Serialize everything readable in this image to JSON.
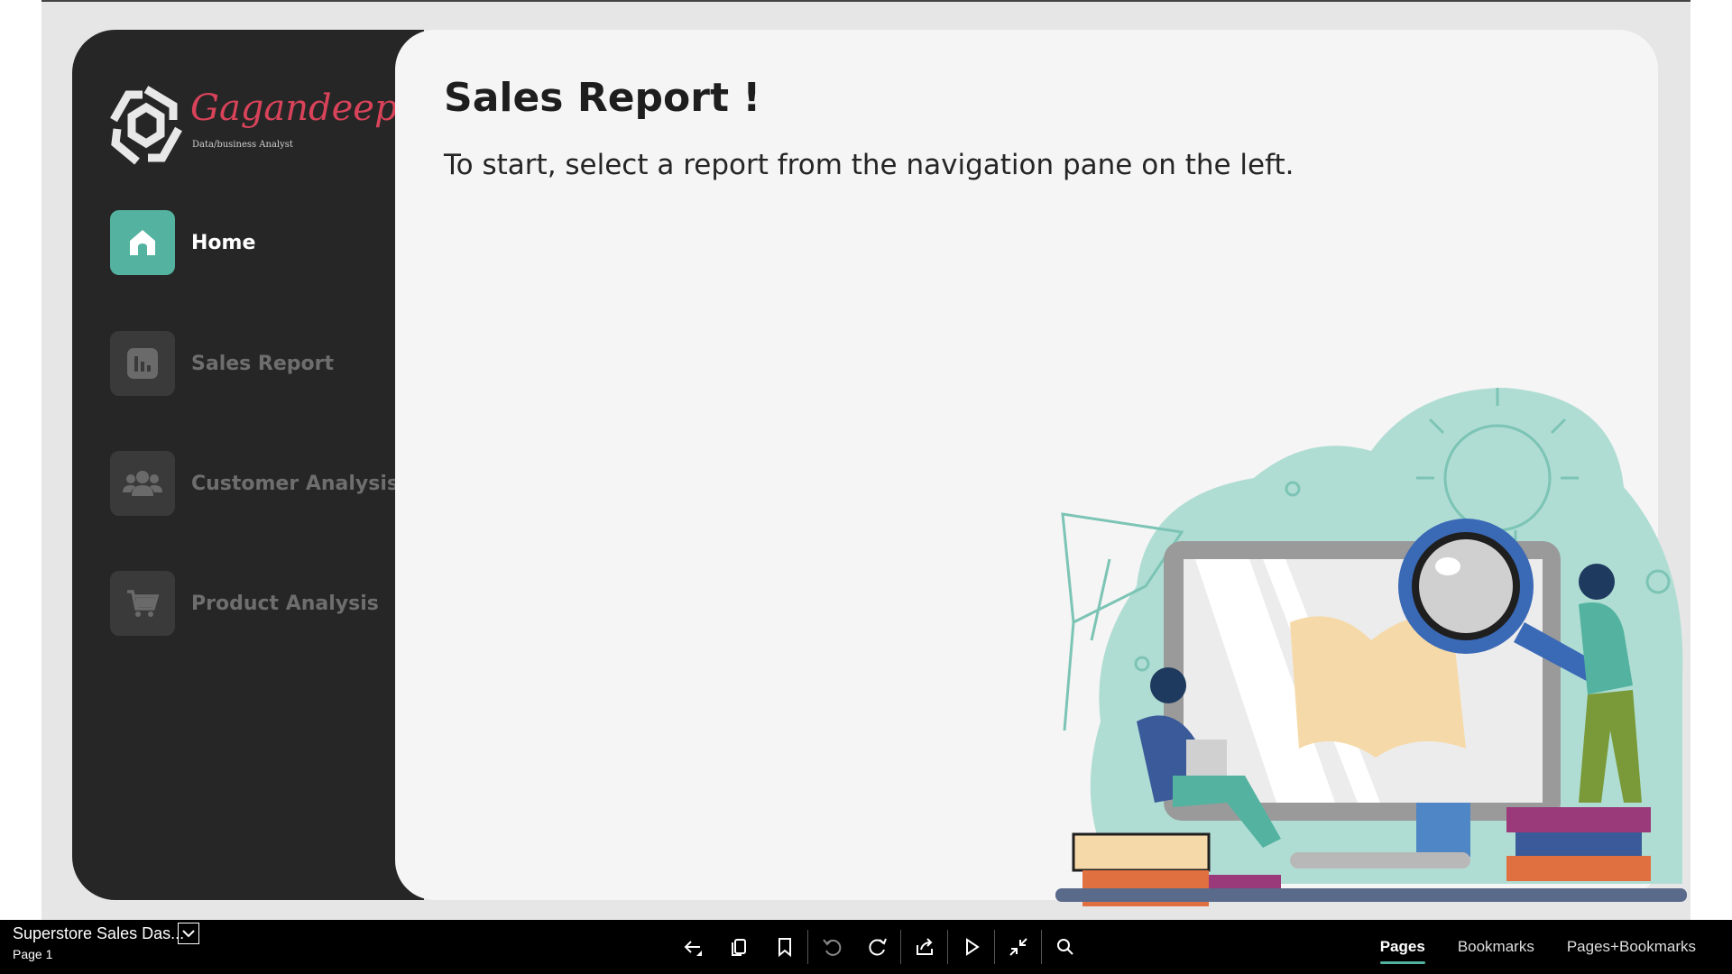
{
  "report": {
    "title": "Sales Report !",
    "subtitle": "To start, select a report from the navigation pane on the left."
  },
  "logo": {
    "name": "Gagandeep",
    "tagline": "Data/business Analyst"
  },
  "nav": {
    "items": [
      {
        "label": "Home",
        "icon": "home-icon",
        "active": true
      },
      {
        "label": "Sales Report",
        "icon": "bar-chart-icon",
        "active": false
      },
      {
        "label": "Customer Analysis",
        "icon": "users-icon",
        "active": false
      },
      {
        "label": "Product Analysis",
        "icon": "cart-icon",
        "active": false
      }
    ]
  },
  "footer": {
    "file_title": "Superstore Sales Das...",
    "page_label": "Page 1",
    "toolbar_icons": [
      "back-icon",
      "copy-icon",
      "bookmark-icon",
      "undo-icon",
      "refresh-icon",
      "share-icon",
      "play-icon",
      "collapse-icon",
      "search-icon"
    ],
    "tabs": [
      {
        "label": "Pages",
        "active": true
      },
      {
        "label": "Bookmarks",
        "active": false
      },
      {
        "label": "Pages+Bookmarks",
        "active": false
      }
    ]
  },
  "colors": {
    "accent": "#53b3a0",
    "sidebar": "#262626",
    "logo": "#d9435a"
  }
}
